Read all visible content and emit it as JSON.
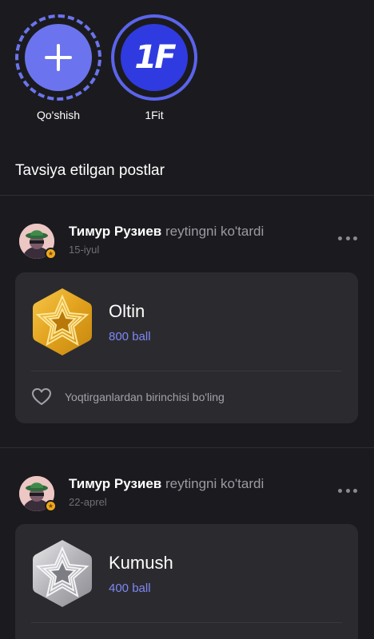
{
  "stories": [
    {
      "label": "Qo'shish",
      "icon": "plus-icon"
    },
    {
      "label": "1Fit",
      "logo_text": "1F"
    }
  ],
  "section": {
    "title": "Tavsiya etilgan postlar"
  },
  "posts": [
    {
      "author": "Тимур Рузиев",
      "action": "reytingni ko'tardi",
      "date": "15-iyul",
      "medal": {
        "title": "Oltin",
        "points": "800 ball",
        "type": "gold"
      },
      "like_text": "Yoqtirganlardan birinchisi bo'ling"
    },
    {
      "author": "Тимур Рузиев",
      "action": "reytingni ko'tardi",
      "date": "22-aprel",
      "medal": {
        "title": "Kumush",
        "points": "400 ball",
        "type": "silver"
      }
    }
  ],
  "colors": {
    "background": "#1b1b1f",
    "accent": "#6b74ee",
    "points": "#7f86f4",
    "gold": "#e0a21f",
    "silver": "#b9b9bd"
  }
}
